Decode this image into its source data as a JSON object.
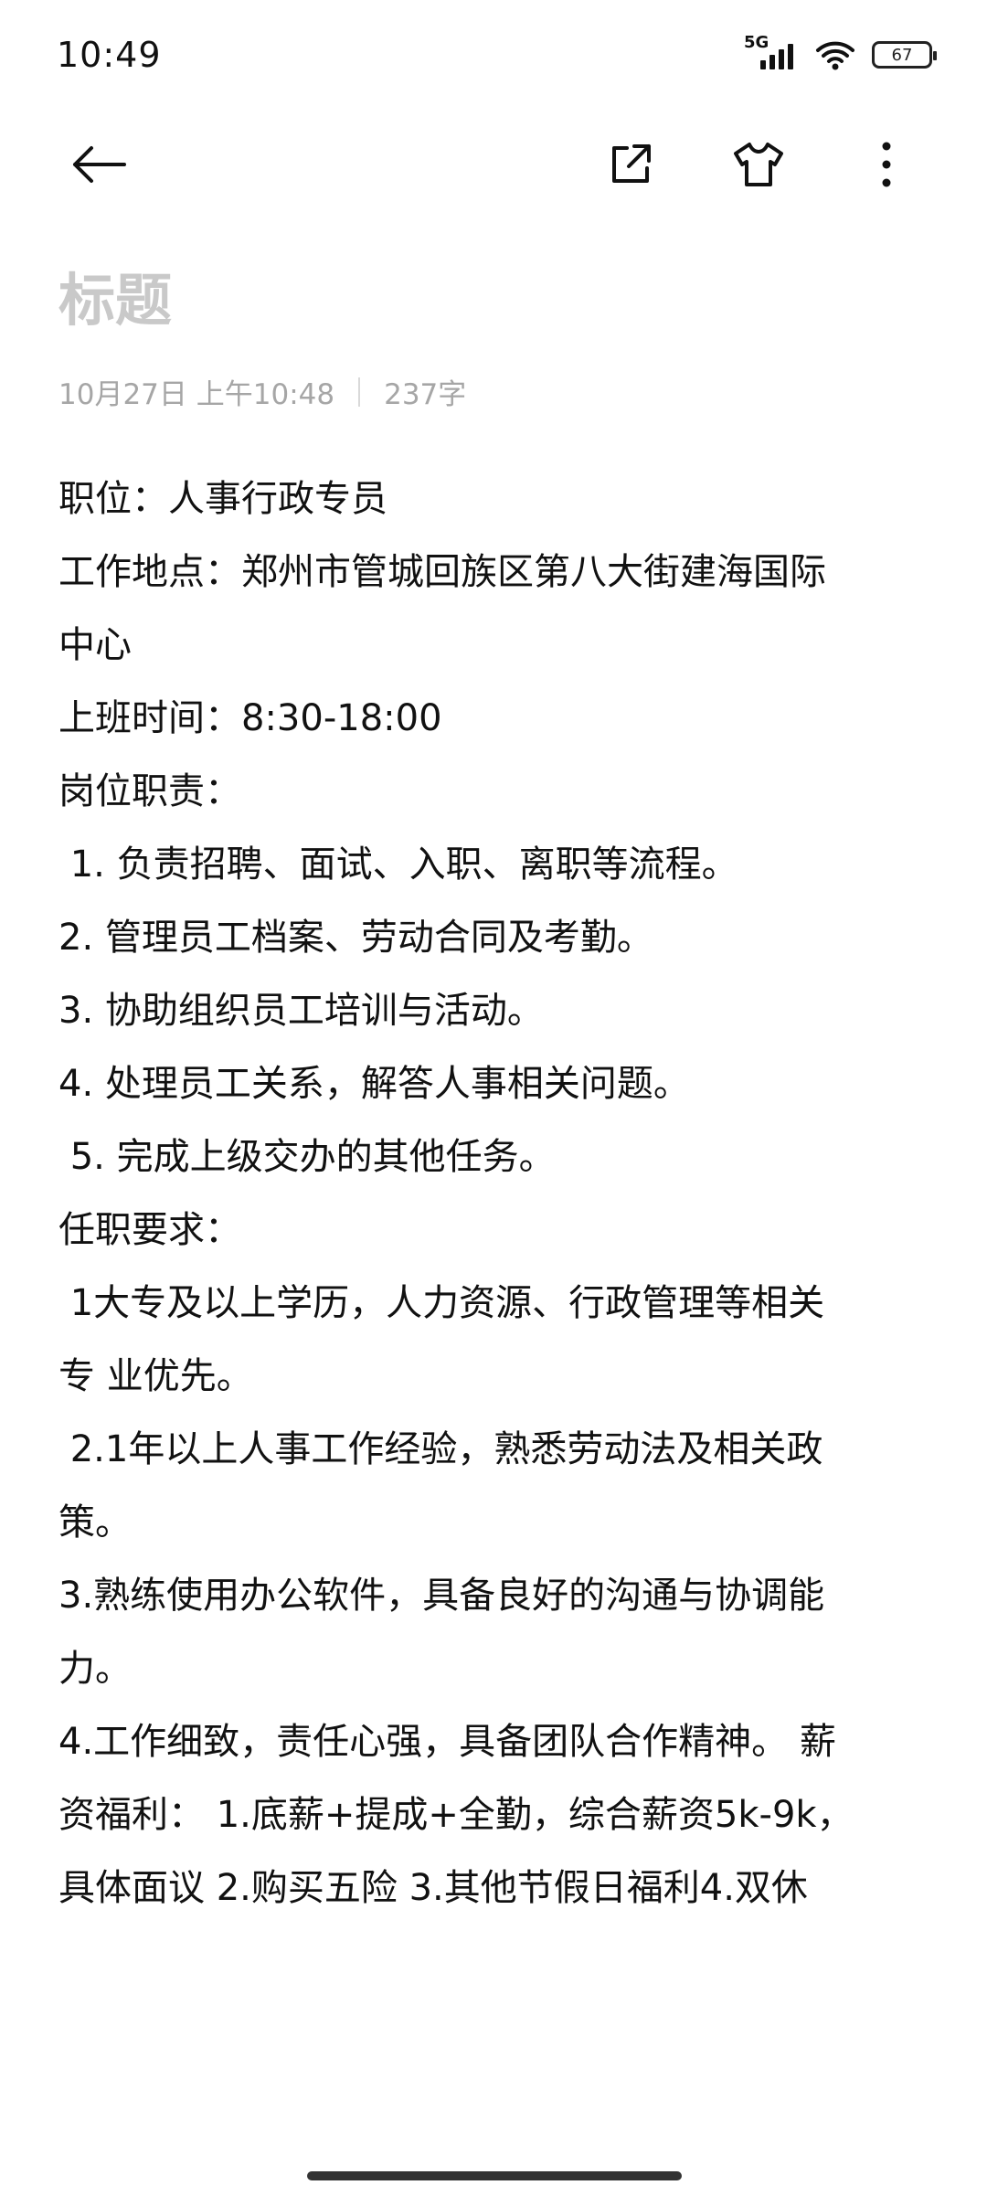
{
  "status_bar": {
    "time": "10:49",
    "network": "5G",
    "battery": "67"
  },
  "toolbar": {
    "back_icon": "back-arrow-icon",
    "share_icon": "share-export-icon",
    "theme_icon": "t-shirt-icon",
    "more_icon": "more-vertical-icon"
  },
  "note": {
    "title_placeholder": "标题",
    "date": "10月27日 上午10:48",
    "word_count": "237字",
    "lines": [
      "职位：人事行政专员",
      "工作地点：郑州市管城回族区第八大街建海国际",
      "中心",
      "上班时间：8:30-18:00",
      "岗位职责：",
      " 1. 负责招聘、面试、入职、离职等流程。",
      "2. 管理员工档案、劳动合同及考勤。",
      "3. 协助组织员工培训与活动。",
      "4. 处理员工关系，解答人事相关问题。",
      " 5. 完成上级交办的其他任务。",
      "任职要求：",
      " 1大专及以上学历，人力资源、行政管理等相关",
      "专 业优先。",
      " 2.1年以上人事工作经验，熟悉劳动法及相关政",
      "策。",
      "3.熟练使用办公软件，具备良好的沟通与协调能",
      "力。",
      "4.工作细致，责任心强，具备团队合作精神。 薪",
      "资福利： 1.底薪+提成+全勤，综合薪资5k-9k，",
      "具体面议 2.购买五险 3.其他节假日福利4.双休"
    ]
  }
}
